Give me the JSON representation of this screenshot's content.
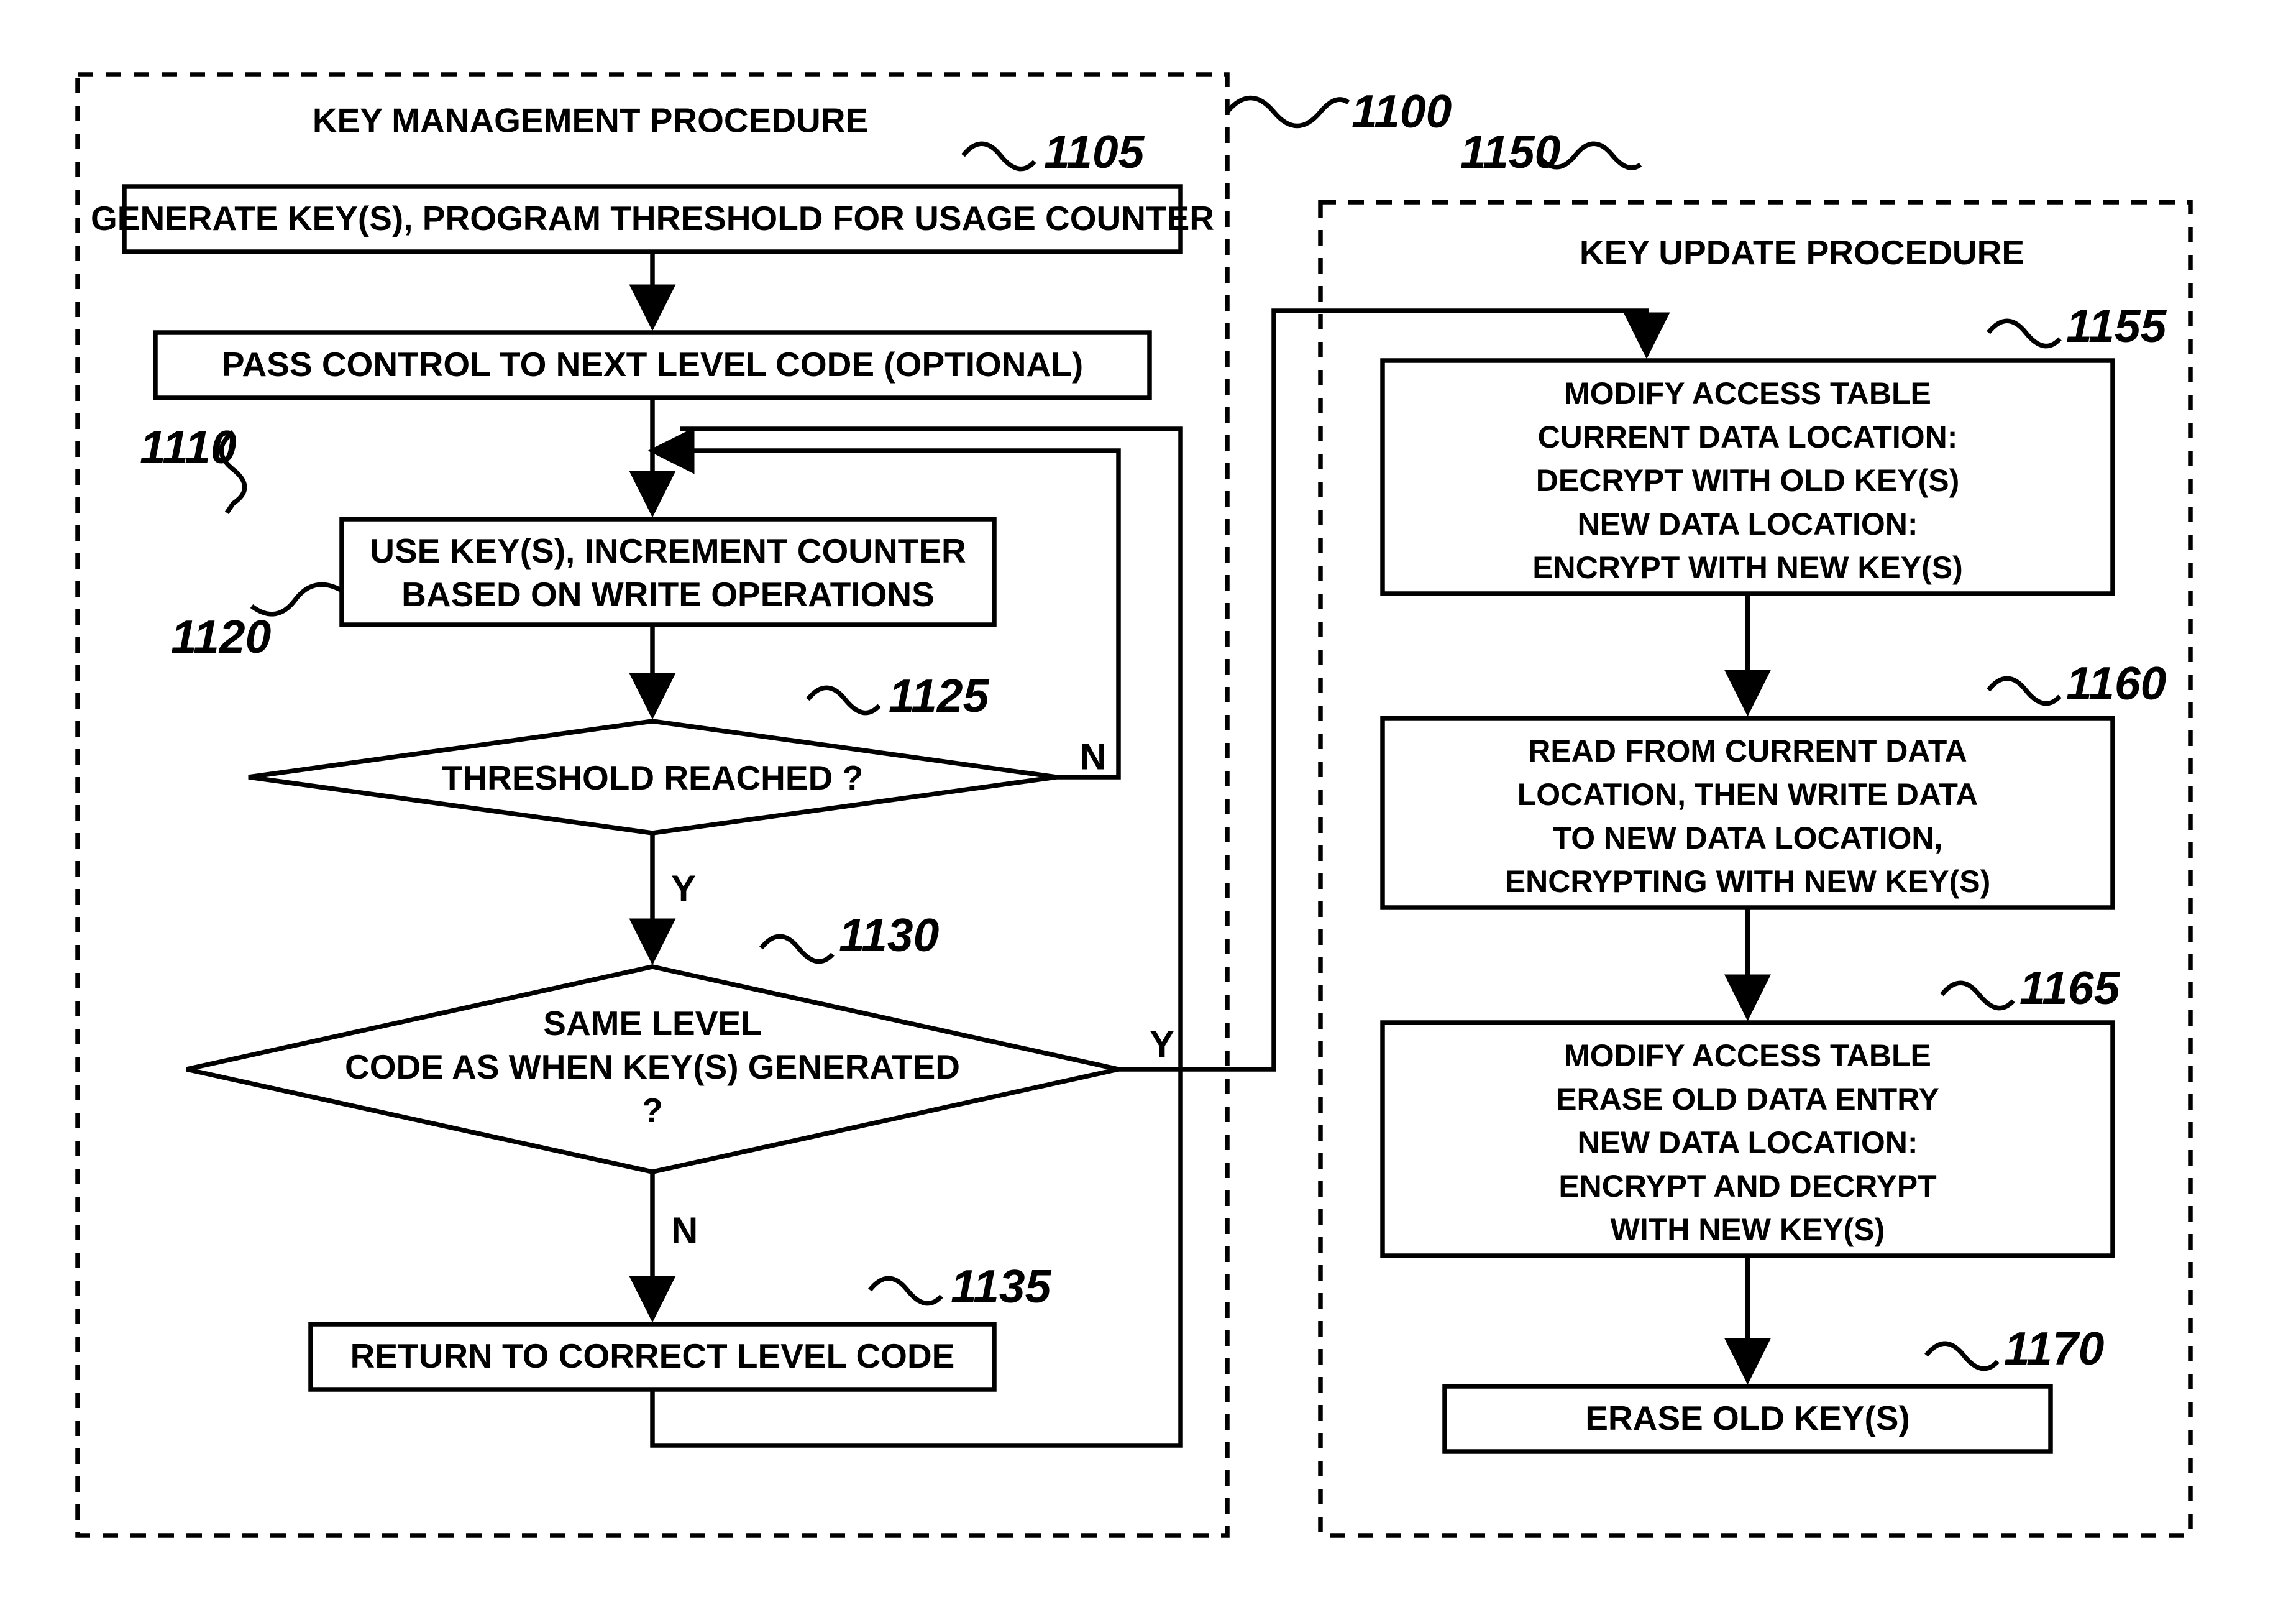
{
  "refs": {
    "r1100": "1100",
    "r1105": "1105",
    "r1110": "1110",
    "r1120": "1120",
    "r1125": "1125",
    "r1130": "1130",
    "r1135": "1135",
    "r1150": "1150",
    "r1155": "1155",
    "r1160": "1160",
    "r1165": "1165",
    "r1170": "1170"
  },
  "titles": {
    "left": "KEY MANAGEMENT PROCEDURE",
    "right": "KEY UPDATE PROCEDURE"
  },
  "boxes": {
    "b1105": "GENERATE KEY(S), PROGRAM THRESHOLD FOR USAGE COUNTER",
    "b1110": "PASS CONTROL TO NEXT LEVEL CODE (OPTIONAL)",
    "b1120a": "USE KEY(S), INCREMENT COUNTER",
    "b1120b": "BASED ON WRITE OPERATIONS",
    "b1125": "THRESHOLD REACHED ?",
    "b1130a": "SAME LEVEL",
    "b1130b": "CODE AS WHEN KEY(S) GENERATED",
    "b1130c": "?",
    "b1135": "RETURN TO CORRECT LEVEL CODE",
    "b1155a": "MODIFY ACCESS TABLE",
    "b1155b": "CURRENT DATA LOCATION:",
    "b1155c": "DECRYPT WITH OLD KEY(S)",
    "b1155d": "NEW DATA LOCATION:",
    "b1155e": "ENCRYPT WITH NEW KEY(S)",
    "b1160a": "READ FROM CURRENT DATA",
    "b1160b": "LOCATION, THEN WRITE DATA",
    "b1160c": "TO NEW DATA LOCATION,",
    "b1160d": "ENCRYPTING WITH NEW KEY(S)",
    "b1165a": "MODIFY ACCESS TABLE",
    "b1165b": "ERASE OLD DATA ENTRY",
    "b1165c": "NEW DATA LOCATION:",
    "b1165d": "ENCRYPT AND DECRYPT",
    "b1165e": "WITH NEW KEY(S)",
    "b1170": "ERASE OLD KEY(S)"
  },
  "yn": {
    "y": "Y",
    "n": "N"
  }
}
